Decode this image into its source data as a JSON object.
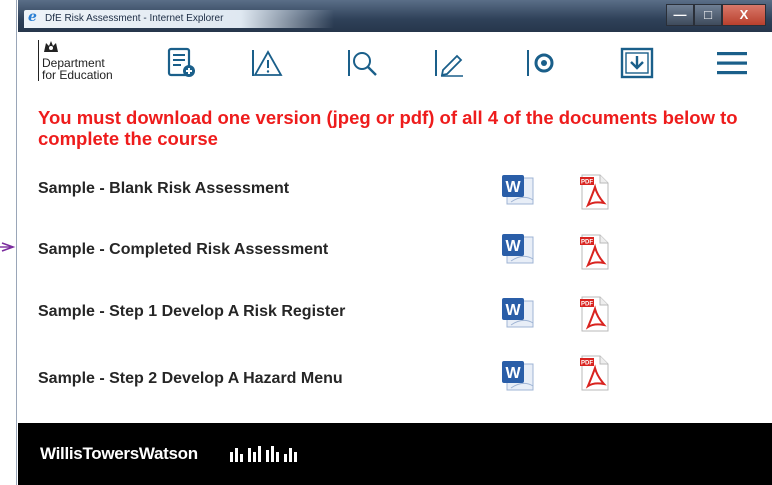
{
  "window": {
    "title": "DfE Risk Assessment - Internet Explorer",
    "minimize": "—",
    "maximize": "□",
    "close": "X"
  },
  "logo": {
    "line1": "Department",
    "line2": "for Education"
  },
  "toolbar": {
    "icons": [
      "document-add-icon",
      "warning-icon",
      "search-icon",
      "edit-icon",
      "eye-icon",
      "download-icon",
      "menu-icon"
    ]
  },
  "heading": "You must download one version (jpeg or pdf) of all 4 of the documents below to complete the course",
  "documents": [
    {
      "label": "Sample - Blank Risk Assessment"
    },
    {
      "label": "Sample - Completed Risk Assessment"
    },
    {
      "label": "Sample - Step 1 Develop A Risk Register"
    },
    {
      "label": "Sample - Step 2 Develop A Hazard Menu"
    }
  ],
  "footer": {
    "brand": "WillisTowersWatson"
  },
  "colors": {
    "accent": "#1a5f8a",
    "heading": "#ee1c1c",
    "footer": "#000000"
  }
}
